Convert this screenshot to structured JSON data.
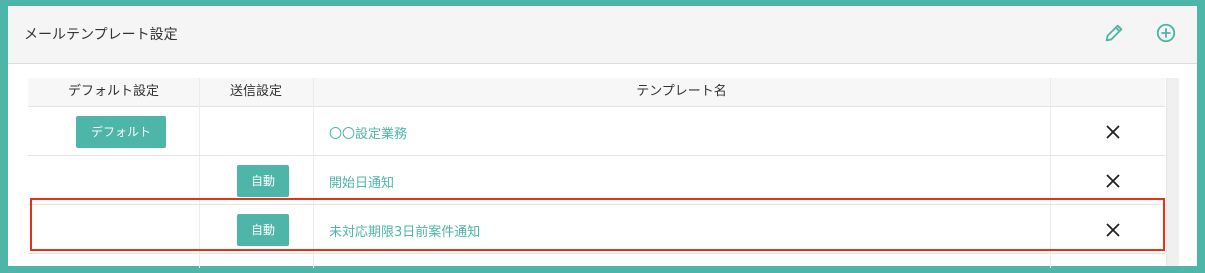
{
  "panel": {
    "title": "メールテンプレート設定",
    "edit_icon": "pencil-icon",
    "add_icon": "plus-circle-icon"
  },
  "table": {
    "headers": [
      "デフォルト設定",
      "送信設定",
      "テンプレート名",
      ""
    ],
    "rows": [
      {
        "default_button": "デフォルト",
        "send_button": "",
        "name": "〇〇設定業務",
        "delete_icon": "close-icon"
      },
      {
        "default_button": "",
        "send_button": "自動",
        "name": "開始日通知",
        "delete_icon": "close-icon"
      },
      {
        "default_button": "",
        "send_button": "自動",
        "name": "未対応期限3日前案件通知",
        "delete_icon": "close-icon"
      }
    ]
  },
  "colors": {
    "accent": "#4db6a8",
    "highlight": "#e2341c",
    "header_bg": "#f5f5f5"
  }
}
